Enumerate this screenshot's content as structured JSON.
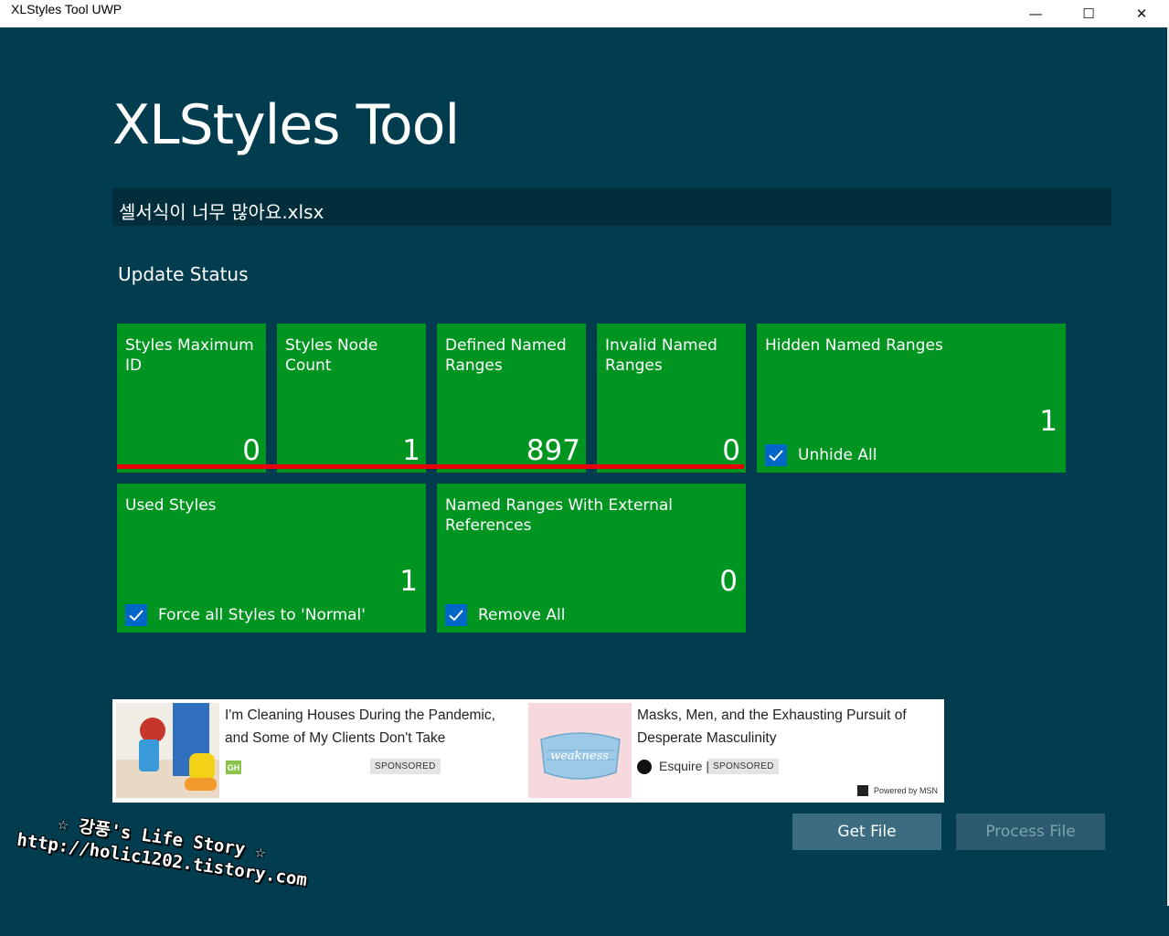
{
  "window": {
    "title": "XLStyles Tool UWP",
    "minimize_glyph": "—",
    "maximize_glyph": "☐",
    "close_glyph": "✕"
  },
  "app_title": "XLStyles Tool",
  "file_name": "셀서식이 너무 많아요.xlsx",
  "section_heading": "Update Status",
  "tiles": [
    {
      "label": "Styles Maximum ID",
      "value": "0"
    },
    {
      "label": "Styles Node Count",
      "value": "1"
    },
    {
      "label": "Defined Named Ranges",
      "value": "897"
    },
    {
      "label": "Invalid Named Ranges",
      "value": "0"
    },
    {
      "label": "Hidden Named Ranges",
      "value": "1",
      "checkbox": "Unhide All",
      "checked": true
    },
    {
      "label": "Used Styles",
      "value": "1",
      "checkbox": "Force all Styles to 'Normal'",
      "checked": true
    },
    {
      "label": "Named Ranges With External References",
      "value": "0",
      "checkbox": "Remove All",
      "checked": true
    }
  ],
  "ad": {
    "items": [
      {
        "headline": "I'm Cleaning Houses During the Pandemic, and Some of My Clients Don't Take",
        "source_badge": "GH",
        "sponsored": "SPONSORED",
        "thumb_word": ""
      },
      {
        "headline": "Masks, Men, and the Exhausting Pursuit of Desperate Masculinity",
        "source": "Esquire |",
        "sponsored": "SPONSORED",
        "thumb_word": "weakness"
      }
    ],
    "powered_by": "Powered by MSN"
  },
  "buttons": {
    "get_file": "Get File",
    "process_file": "Process File"
  },
  "watermark": {
    "line1": "☆ 강풍's Life Story ☆",
    "line2": "http://holic1202.tistory.com"
  },
  "colors": {
    "background": "#023d4f",
    "tile": "#009521",
    "warning_line": "#e8000a",
    "checkbox": "#0067c8",
    "button_enabled": "#3b6c80",
    "button_disabled": "#2a5a6b"
  }
}
